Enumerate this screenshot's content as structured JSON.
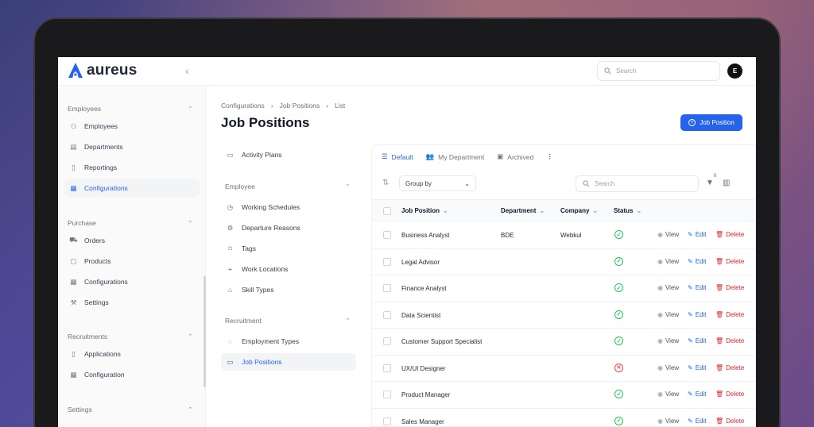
{
  "app": {
    "name": "aureus",
    "user_initial": "E",
    "search_placeholder": "Search"
  },
  "sidebar": {
    "groups": [
      {
        "label": "Employees",
        "items": [
          "Employees",
          "Departments",
          "Reportings",
          "Configurations"
        ]
      },
      {
        "label": "Purchase",
        "items": [
          "Orders",
          "Products",
          "Configurations",
          "Settings"
        ]
      },
      {
        "label": "Recruitments",
        "items": [
          "Applications",
          "Configuration"
        ]
      },
      {
        "label": "Settings",
        "items": []
      }
    ]
  },
  "breadcrumb": [
    "Configurations",
    "Job Positions",
    "List"
  ],
  "page": {
    "title": "Job Positions",
    "new_button": "Job Position"
  },
  "config_nav": {
    "top_item": "Activity Plans",
    "employee_label": "Employee",
    "employee_items": [
      "Working Schedules",
      "Departure Reasons",
      "Tags",
      "Work Locations",
      "Skill Types"
    ],
    "recruitment_label": "Recruitment",
    "recruitment_items": [
      "Employment Types",
      "Job Positions"
    ]
  },
  "table": {
    "tabs": [
      "Default",
      "My Department",
      "Archived"
    ],
    "group_by": "Group by",
    "search_placeholder": "Search",
    "filter_count": "0",
    "columns": [
      "Job Position",
      "Department",
      "Company",
      "Status"
    ],
    "actions": {
      "view": "View",
      "edit": "Edit",
      "delete": "Delete"
    },
    "rows": [
      {
        "position": "Business Analyst",
        "department": "BDE",
        "company": "Webkul",
        "status": "active"
      },
      {
        "position": "Legal Advisor",
        "department": "",
        "company": "",
        "status": "active"
      },
      {
        "position": "Finance Analyst",
        "department": "",
        "company": "",
        "status": "active"
      },
      {
        "position": "Data Scientist",
        "department": "",
        "company": "",
        "status": "active"
      },
      {
        "position": "Customer Support Specialist",
        "department": "",
        "company": "",
        "status": "active"
      },
      {
        "position": "UX/UI Designer",
        "department": "",
        "company": "",
        "status": "inactive"
      },
      {
        "position": "Product Manager",
        "department": "",
        "company": "",
        "status": "active"
      },
      {
        "position": "Sales Manager",
        "department": "",
        "company": "",
        "status": "active"
      }
    ]
  },
  "colors": {
    "accent": "#2563eb",
    "success": "#22c55e",
    "danger": "#dc2626"
  }
}
